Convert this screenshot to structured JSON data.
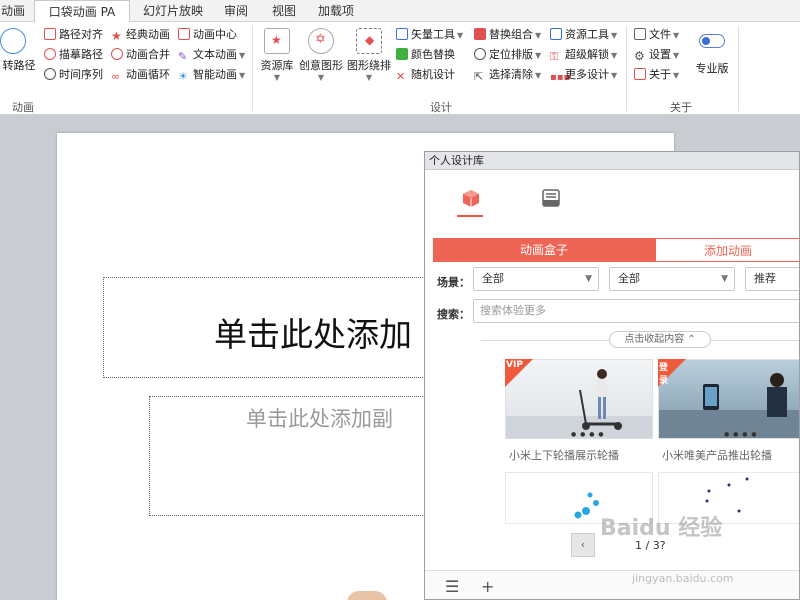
{
  "tabs": [
    "动画",
    "口袋动画 PA",
    "幻灯片放映",
    "审阅",
    "视图",
    "加载项"
  ],
  "ribbon": {
    "group_animation_label": "动画",
    "group_design_label": "设计",
    "group_about_label": "关于",
    "left_big": "转路径",
    "col1": [
      "路径对齐",
      "描摹路径",
      "时间序列"
    ],
    "col2": [
      "经典动画",
      "动画合并",
      "动画循环"
    ],
    "col3": [
      "动画中心",
      "文本动画",
      "智能动画"
    ],
    "big_buttons": [
      "资源库",
      "创意图形",
      "图形绕排"
    ],
    "col4": [
      "矢量工具",
      "颜色替换",
      "随机设计"
    ],
    "col5": [
      "替换组合",
      "定位排版",
      "选择清除"
    ],
    "col6": [
      "资源工具",
      "超级解锁",
      "更多设计"
    ],
    "col7": [
      "文件",
      "设置",
      "关于"
    ],
    "pro_label": "专业版"
  },
  "slide": {
    "title_placeholder": "单击此处添加",
    "subtitle_placeholder": "单击此处添加副"
  },
  "panel": {
    "title": "个人设计库",
    "seg_on": "动画盒子",
    "seg_off": "添加动画",
    "scene_label": "场景：",
    "scene_value": "全部",
    "filter2_value": "全部",
    "sort_value": "推荐",
    "search_label": "搜索：",
    "search_placeholder": "搜索体验更多",
    "collapse_label": "点击收起内容 ⌃",
    "cards": [
      {
        "title": "小米上下轮播展示轮播",
        "badge": "VIP"
      },
      {
        "title": "小米唯美产品推出轮播",
        "badge": "登录"
      }
    ],
    "pager_text": "1 / 3?",
    "foot_menu": "☰",
    "foot_add": "+"
  },
  "watermark": {
    "brand": "Baidu 经验",
    "url": "jingyan.baidu.com"
  },
  "colors": {
    "accent": "#ee6555",
    "panel_title_bg": "#e3e5e8"
  }
}
